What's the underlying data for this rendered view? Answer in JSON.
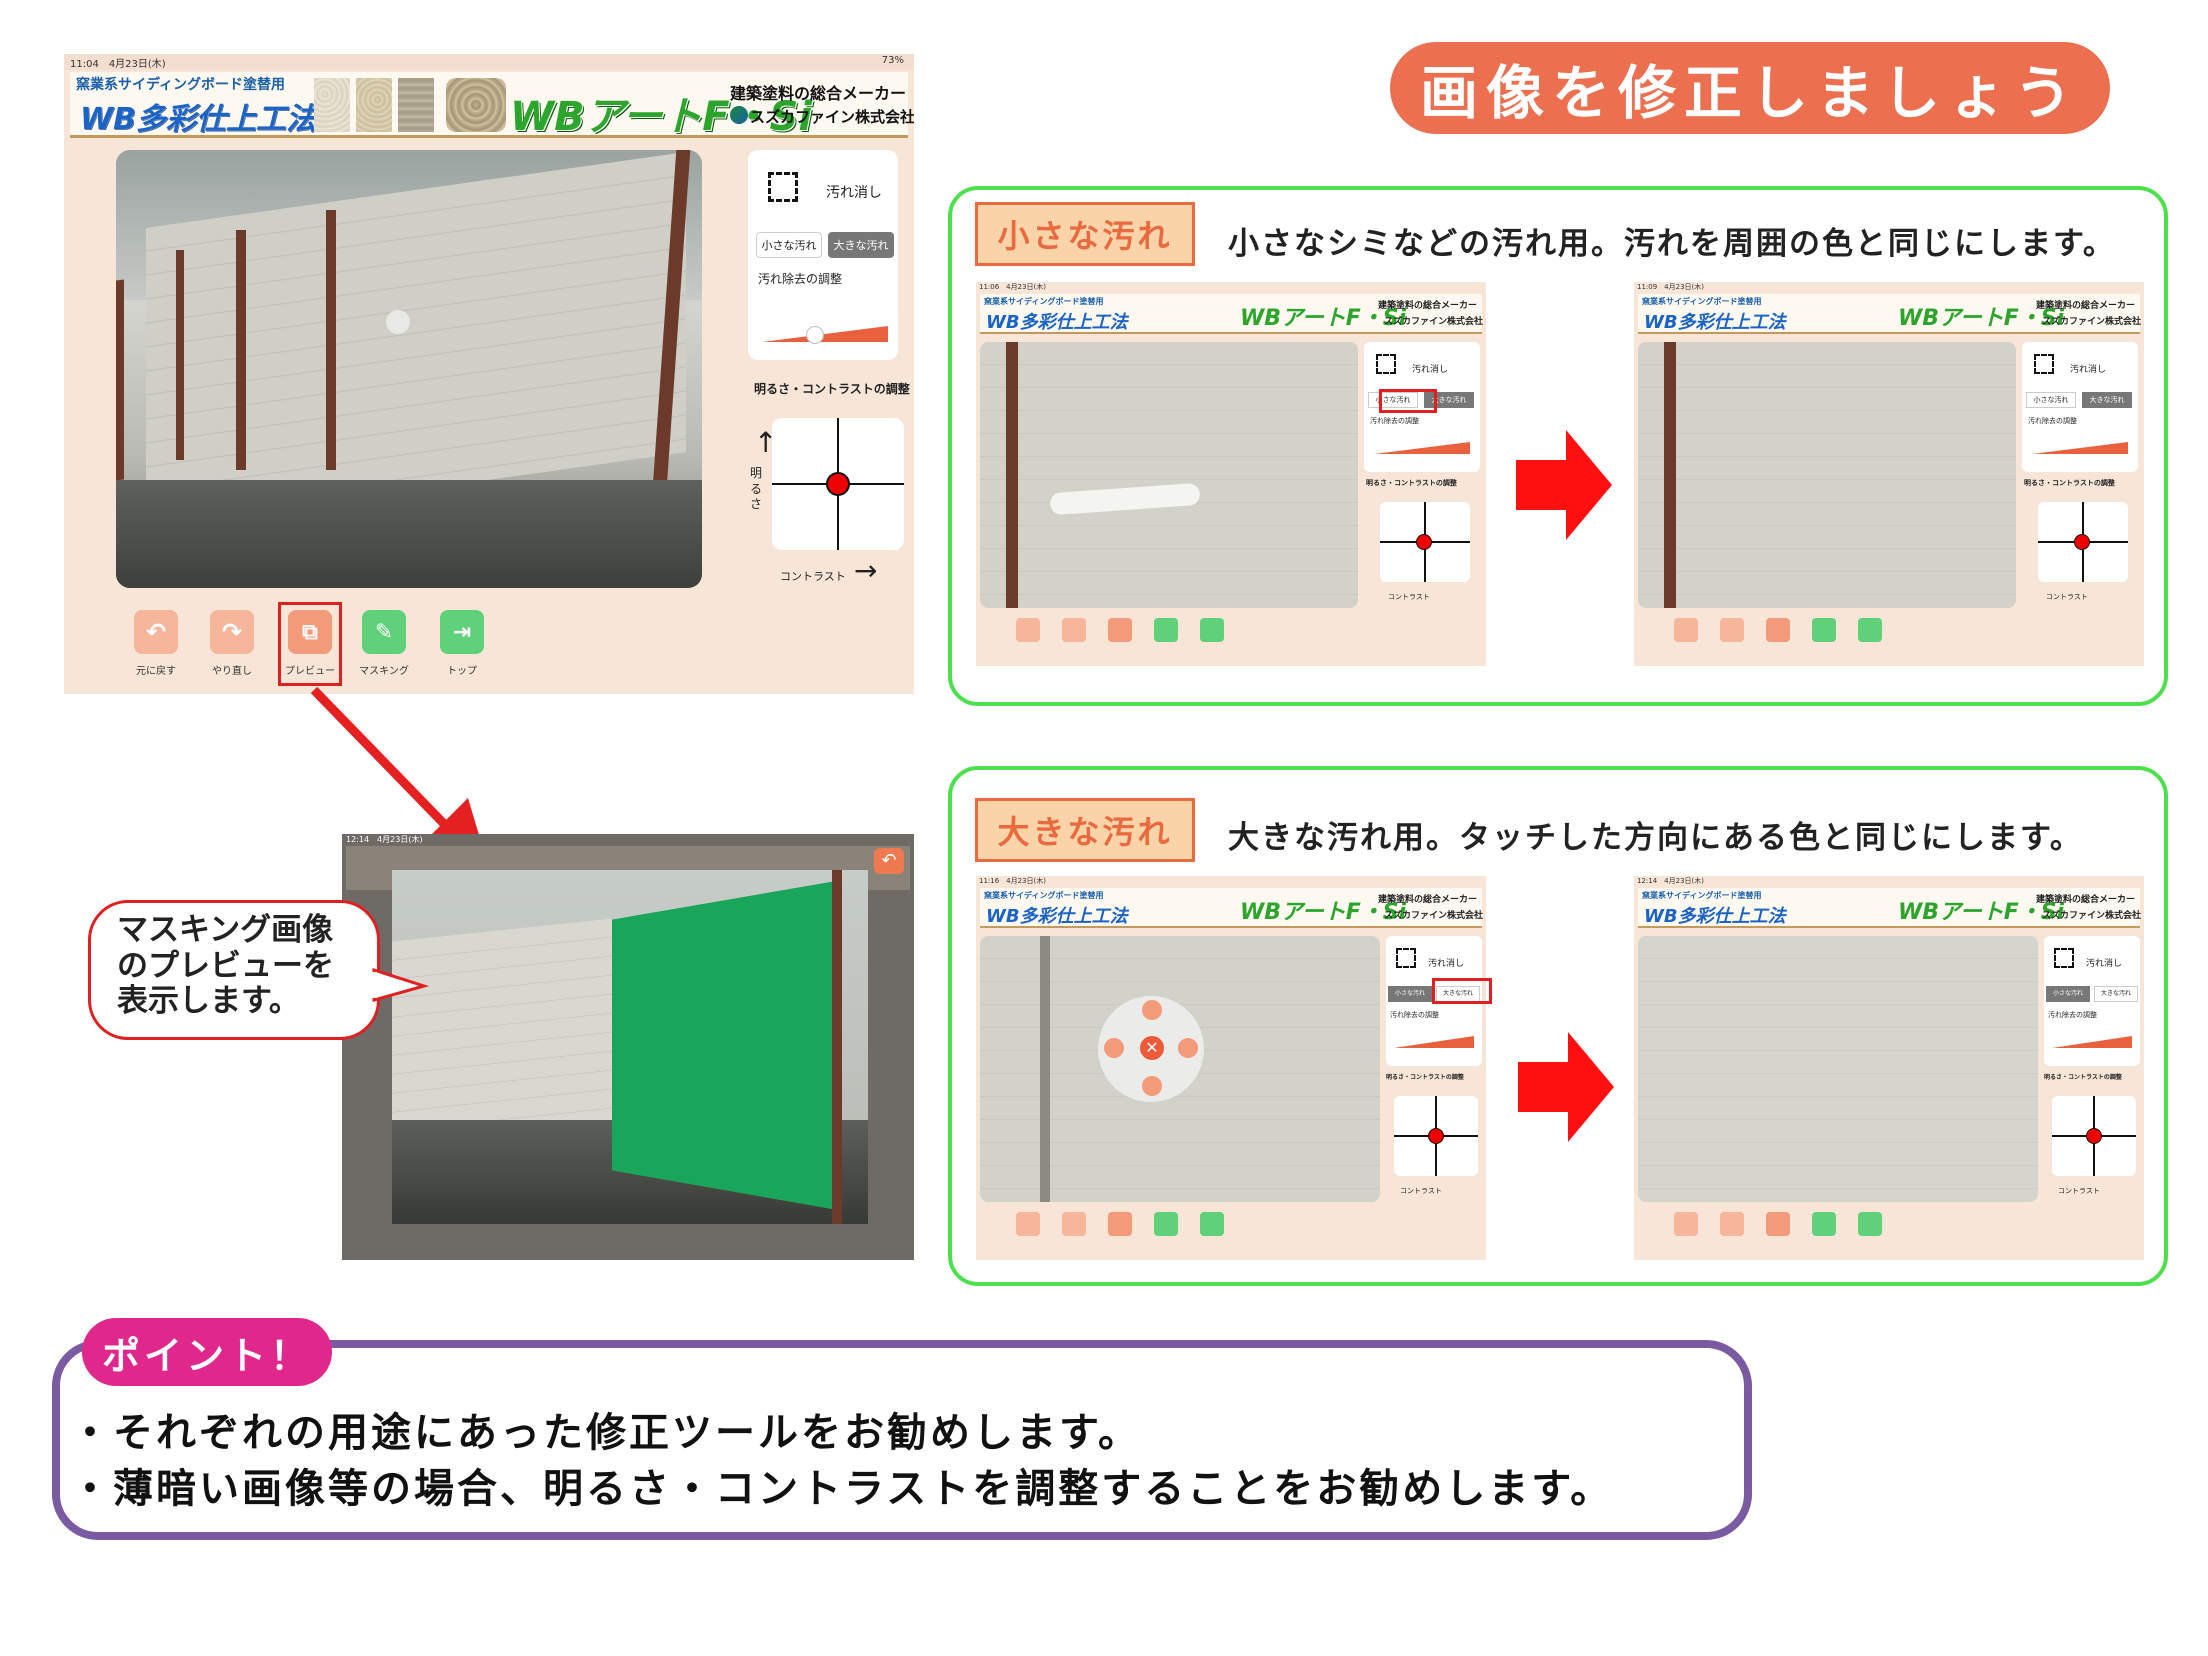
{
  "page_title": "画像を修正しましょう",
  "main_screen": {
    "status_time": "11:04　4月23日(木)",
    "status_battery": "73%",
    "banner": {
      "subtitle": "窯業系サイディングボード塗替用",
      "title": "WB多彩仕上工法",
      "logo": "WBアートF・Si",
      "maker": "建築塗料の総合メーカー",
      "company": "スズカファイン株式会社"
    },
    "panel": {
      "stain_remove": "汚れ消し",
      "small_stain": "小さな汚れ",
      "large_stain": "大きな汚れ",
      "adjust_label": "汚れ除去の調整",
      "bc_label": "明るさ・コントラストの調整",
      "brightness": "明るさ",
      "contrast": "コントラスト"
    },
    "toolbar": {
      "undo": "元に戻す",
      "redo": "やり直し",
      "preview": "プレビュー",
      "masking": "マスキング",
      "top": "トップ"
    }
  },
  "preview_screen": {
    "status_time": "12:14　4月23日(木)",
    "callout": [
      "マスキング画像",
      "のプレビューを",
      "表示します。"
    ]
  },
  "small_section": {
    "tag": "小さな汚れ",
    "description": "小さなシミなどの汚れ用。汚れを周囲の色と同じにします。",
    "before_time": "11:06　4月23日(木)",
    "after_time": "11:09　4月23日(木)"
  },
  "large_section": {
    "tag": "大きな汚れ",
    "description": "大きな汚れ用。タッチした方向にある色と同じにします。",
    "before_time": "11:16　4月23日(木)",
    "after_time": "12:14　4月23日(木)"
  },
  "point": {
    "tag": "ポイント！",
    "lines": [
      "・それぞれの用途にあった修正ツールをお勧めします。",
      "・薄暗い画像等の場合、明るさ・コントラストを調整することをお勧めします。"
    ]
  },
  "colors": {
    "title_bg": "#ec6f4f",
    "section_border": "#4de04d",
    "tag_bg": "#fbd3a9",
    "tag_text": "#e86a3e",
    "point_border": "#7a5aa0",
    "point_tag": "#e0288c",
    "highlight": "#e02020",
    "button_orange": "#f39a7a",
    "button_green": "#5fd17a"
  }
}
